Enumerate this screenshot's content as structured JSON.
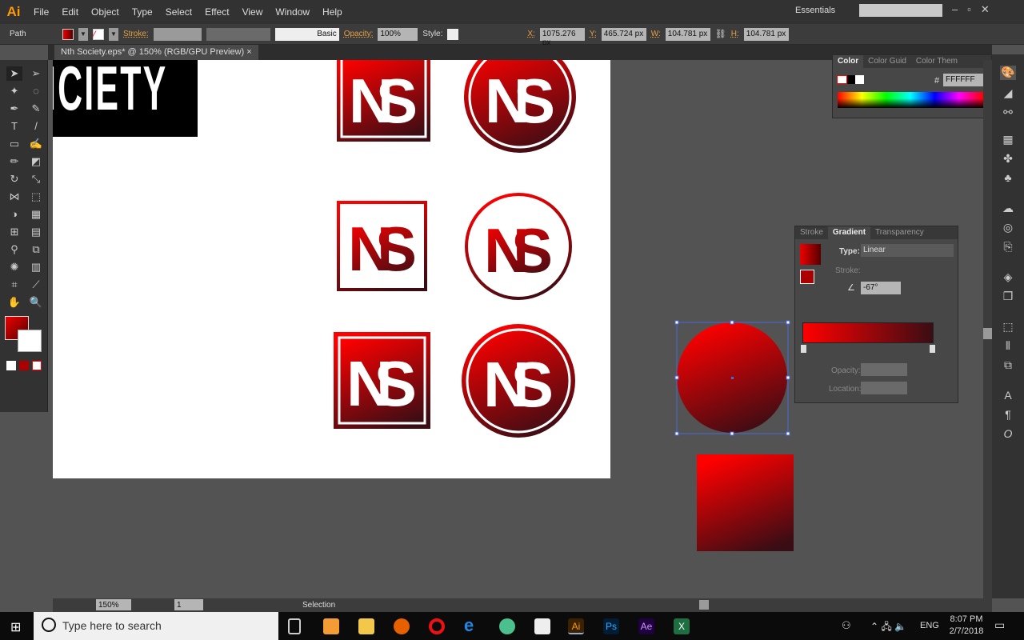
{
  "app": {
    "logo": "Ai",
    "menus": [
      "File",
      "Edit",
      "Object",
      "Type",
      "Select",
      "Effect",
      "View",
      "Window",
      "Help"
    ],
    "workspace": "Essentials",
    "search_placeholder": ""
  },
  "control": {
    "selection": "Path",
    "stroke_label": "Stroke:",
    "brush": "Basic",
    "opacity_label": "Opacity:",
    "opacity": "100%",
    "style_label": "Style:",
    "x_label": "X:",
    "x": "1075.276 px",
    "y_label": "Y:",
    "y": "465.724 px",
    "w_label": "W:",
    "w": "104.781 px",
    "h_label": "H:",
    "h": "104.781 px"
  },
  "document": {
    "tab": "Nth Society.eps* @ 150% (RGB/GPU Preview)",
    "close": "×"
  },
  "artwork": {
    "logo_text": "NS",
    "society_fragment": "ICIETY"
  },
  "colors": {
    "gradient_start": "#ff0000",
    "gradient_end": "#3a0d14",
    "fill": "#c00000"
  },
  "color_panel": {
    "tabs": [
      "Color",
      "Color Guid",
      "Color Them"
    ],
    "hex_label": "#",
    "hex": "FFFFFF"
  },
  "gradient_panel": {
    "tabs": [
      "Stroke",
      "Gradient",
      "Transparency"
    ],
    "type_label": "Type:",
    "type": "Linear",
    "stroke_label": "Stroke:",
    "angle": "-67°",
    "opacity_label": "Opacity:",
    "location_label": "Location:"
  },
  "status": {
    "zoom": "150%",
    "artboard": "1",
    "tool": "Selection"
  },
  "taskbar": {
    "search_placeholder": "Type here to search",
    "lang": "ENG",
    "time": "8:07 PM",
    "date": "2/7/2018"
  }
}
